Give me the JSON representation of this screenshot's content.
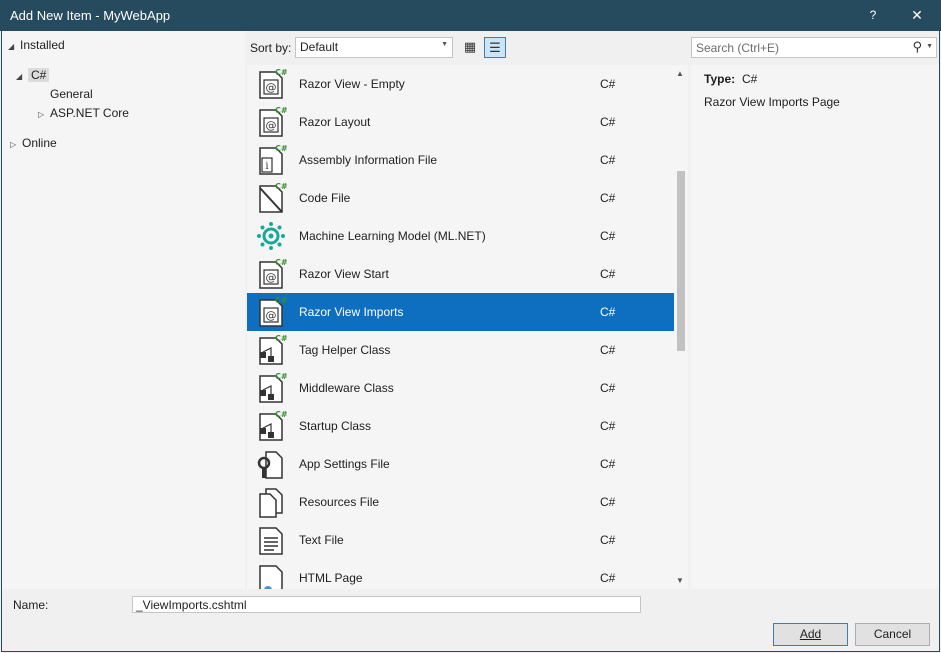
{
  "window": {
    "title": "Add New Item - MyWebApp",
    "help_glyph": "?",
    "close_glyph": "✕"
  },
  "tree": {
    "installed": "Installed",
    "csharp": "C#",
    "general": "General",
    "aspnet": "ASP.NET Core",
    "online": "Online"
  },
  "toolbar": {
    "sort_label": "Sort by:",
    "sort_value": "Default",
    "search_placeholder": "Search (Ctrl+E)"
  },
  "templates": [
    {
      "name": "Razor View - Empty",
      "lang": "C#",
      "icon": "razor-page-icon"
    },
    {
      "name": "Razor Layout",
      "lang": "C#",
      "icon": "razor-page-icon"
    },
    {
      "name": "Assembly Information File",
      "lang": "C#",
      "icon": "info-file-icon"
    },
    {
      "name": "Code File",
      "lang": "C#",
      "icon": "code-file-icon"
    },
    {
      "name": "Machine Learning Model (ML.NET)",
      "lang": "C#",
      "icon": "ml-gear-icon"
    },
    {
      "name": "Razor View Start",
      "lang": "C#",
      "icon": "razor-page-icon"
    },
    {
      "name": "Razor View Imports",
      "lang": "C#",
      "icon": "razor-page-icon",
      "selected": true
    },
    {
      "name": "Tag Helper Class",
      "lang": "C#",
      "icon": "class-file-icon"
    },
    {
      "name": "Middleware Class",
      "lang": "C#",
      "icon": "class-file-icon"
    },
    {
      "name": "Startup Class",
      "lang": "C#",
      "icon": "class-file-icon"
    },
    {
      "name": "App Settings File",
      "lang": "C#",
      "icon": "settings-wrench-icon"
    },
    {
      "name": "Resources File",
      "lang": "C#",
      "icon": "resources-file-icon"
    },
    {
      "name": "Text File",
      "lang": "C#",
      "icon": "text-file-icon"
    },
    {
      "name": "HTML Page",
      "lang": "C#",
      "icon": "html-file-icon"
    }
  ],
  "details": {
    "type_label": "Type:",
    "type_value": "C#",
    "description": "Razor View Imports Page"
  },
  "footer": {
    "name_label": "Name:",
    "name_value": "_ViewImports.cshtml",
    "add_label": "Add",
    "cancel_label": "Cancel"
  },
  "colors": {
    "titlebar": "#264a5e",
    "selection": "#0e6fc0",
    "csharp_badge": "#388a34",
    "ml_teal": "#1aa89a"
  }
}
